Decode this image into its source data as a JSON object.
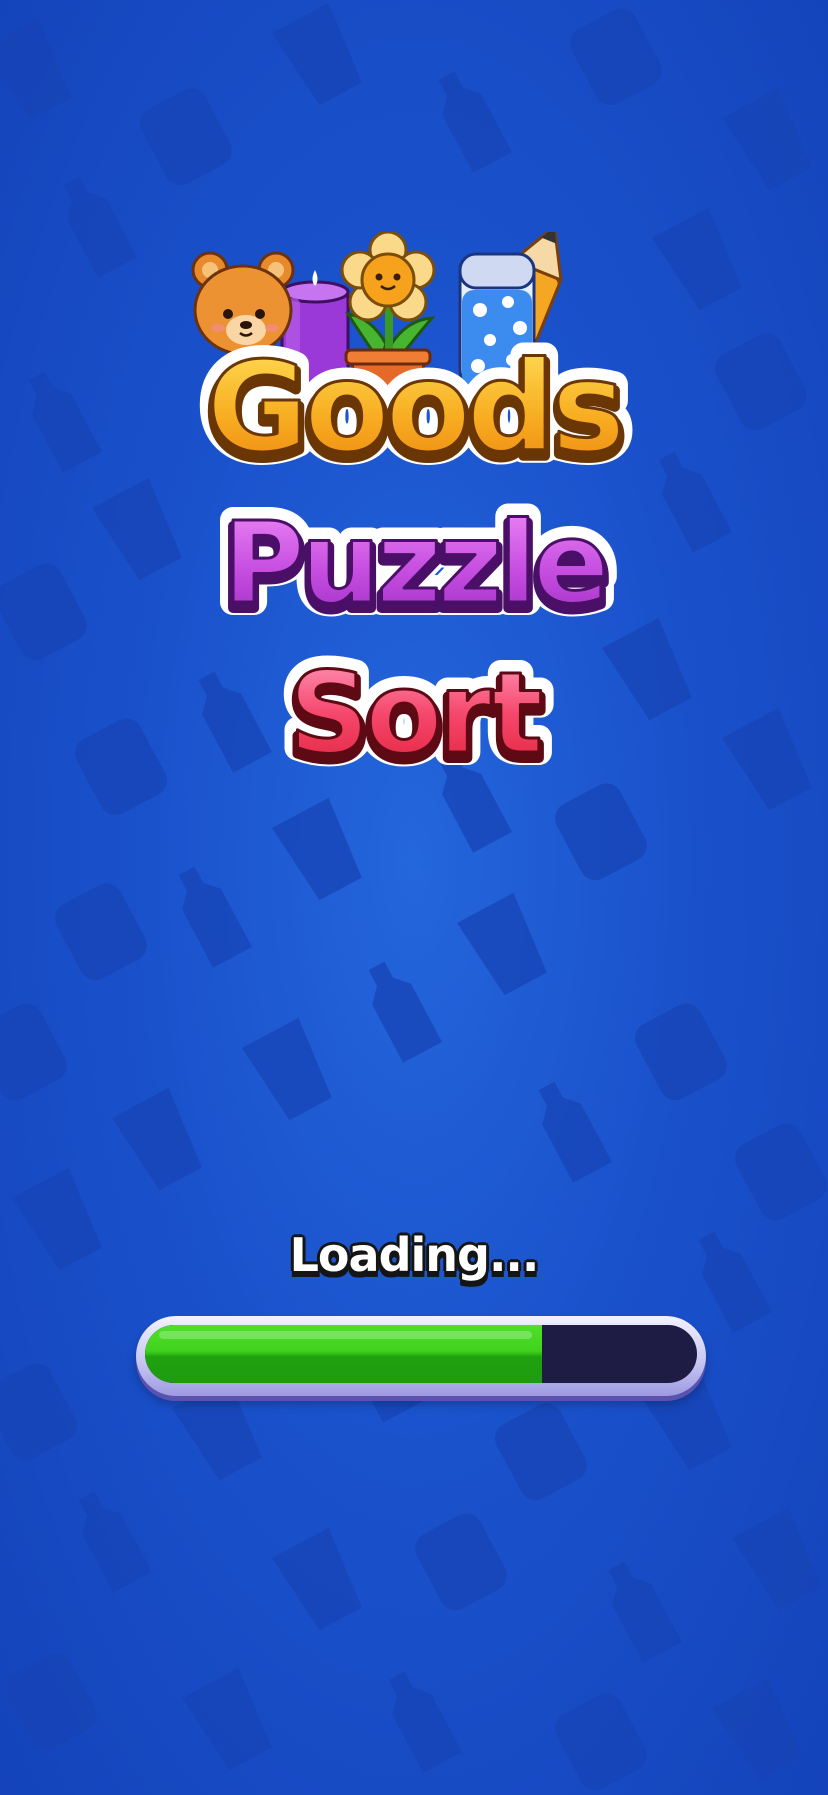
{
  "game": {
    "logo": {
      "line1": "Goods",
      "line2": "Puzzle",
      "line3": "Sort",
      "items": [
        "teddy-bear",
        "candle",
        "flower-pot",
        "water-bottle",
        "pencil"
      ]
    },
    "loading": {
      "label": "Loading...",
      "progress": 0.72
    }
  },
  "colors": {
    "background": "#1a52cc",
    "goods": "#f7a51c",
    "puzzle": "#c44ddc",
    "sort": "#f03a5a",
    "progress_fill": "#3fcd1d",
    "progress_track": "#1e1b45",
    "progress_frame": "#c9c9f3"
  }
}
